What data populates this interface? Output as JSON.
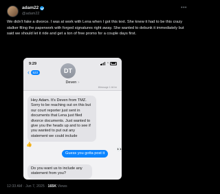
{
  "tweet": {
    "display_name": "adam22",
    "handle": "@adam22",
    "text": "We didn't fake a divorce. I was at work with Lena when I got this text. She knew it had to be this crazy stalker filing the paperwork with forged signatures right away. She wanted to debunk it immediately but said we should let it ride and get a ton of free promo for a couple days first.",
    "more_label": "•••",
    "timestamp": "12:33 AM · Jun 7, 2025 ·",
    "views_count": "165K",
    "views_label": "Views"
  },
  "screenshot": {
    "time": "9:29",
    "back_count": "523",
    "contact_initials": "DT",
    "contact_name": "Deven",
    "contact_chevron": ">",
    "delivered": "iMessage 1 bit lm",
    "message_in_1": "Hey Adam. It's Deven from TMZ. Sorry to be reaching out on this but our court reporter just sent in documents that Lena just filed divorce documents. Just wanted to give you the heads up and to see if you wanted to put out any statement we could include",
    "reaction_emoji": "👍",
    "message_out": "Guess you gotta post it",
    "out_emoji": "👀",
    "message_in_2": "Do you want us to include any statement from you?"
  }
}
